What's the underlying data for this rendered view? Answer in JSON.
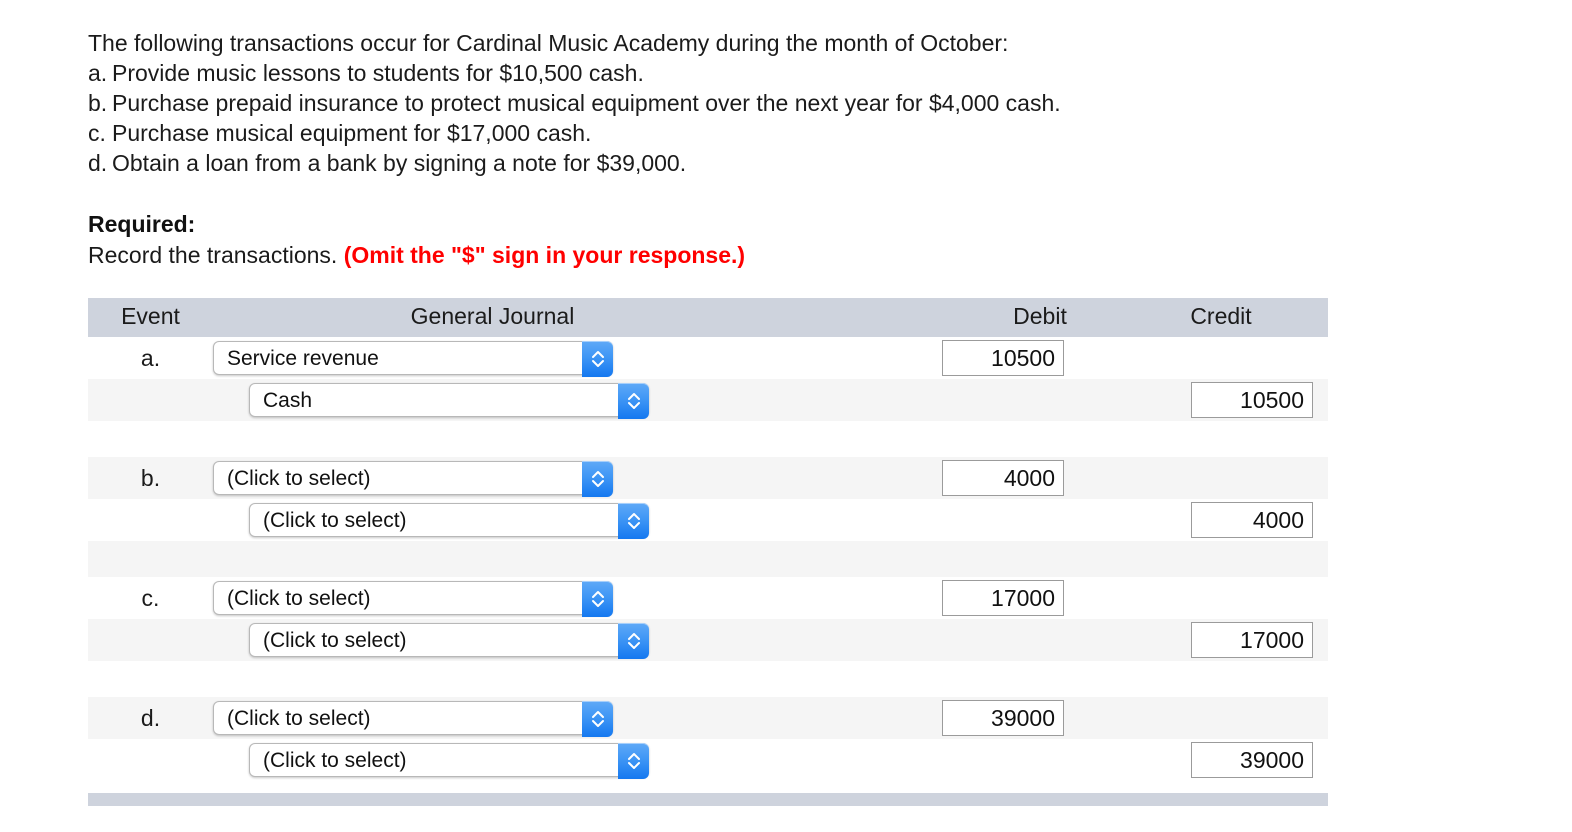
{
  "problem": {
    "intro": "The following transactions occur for Cardinal Music Academy during the month of October:",
    "items": [
      {
        "marker": "a.",
        "text": "Provide music lessons to students for $10,500 cash."
      },
      {
        "marker": "b.",
        "text": "Purchase prepaid insurance to protect musical equipment over the next year for $4,000 cash."
      },
      {
        "marker": "c.",
        "text": "Purchase musical equipment for $17,000 cash."
      },
      {
        "marker": "d.",
        "text": "Obtain a loan from a bank by signing a note for $39,000."
      }
    ]
  },
  "required": {
    "label": "Required:",
    "instruction": "Record the transactions.",
    "omit_note": "(Omit the \"$\" sign in your response.)",
    "omit_note_color": "#ff0000"
  },
  "table": {
    "headers": {
      "event": "Event",
      "general_journal": "General Journal",
      "debit": "Debit",
      "credit": "Credit"
    },
    "header_bg": "#ced3dd",
    "stepper_color": "#3f96f5",
    "placeholder": "(Click to select)",
    "entries": [
      {
        "event": "a.",
        "lines": [
          {
            "account": "Service revenue",
            "indent": false,
            "debit": "10500",
            "credit": "",
            "stripe": "white"
          },
          {
            "account": "Cash",
            "indent": true,
            "debit": "",
            "credit": "10500",
            "stripe": "gray"
          }
        ],
        "spacer_stripe": "white"
      },
      {
        "event": "b.",
        "lines": [
          {
            "account": "(Click to select)",
            "indent": false,
            "debit": "4000",
            "credit": "",
            "stripe": "gray"
          },
          {
            "account": "(Click to select)",
            "indent": true,
            "debit": "",
            "credit": "4000",
            "stripe": "white"
          }
        ],
        "spacer_stripe": "gray"
      },
      {
        "event": "c.",
        "lines": [
          {
            "account": "(Click to select)",
            "indent": false,
            "debit": "17000",
            "credit": "",
            "stripe": "white"
          },
          {
            "account": "(Click to select)",
            "indent": true,
            "debit": "",
            "credit": "17000",
            "stripe": "gray"
          }
        ],
        "spacer_stripe": "white"
      },
      {
        "event": "d.",
        "lines": [
          {
            "account": "(Click to select)",
            "indent": false,
            "debit": "39000",
            "credit": "",
            "stripe": "gray"
          },
          {
            "account": "(Click to select)",
            "indent": true,
            "debit": "",
            "credit": "39000",
            "stripe": "white"
          }
        ],
        "spacer_stripe": "white"
      }
    ]
  }
}
